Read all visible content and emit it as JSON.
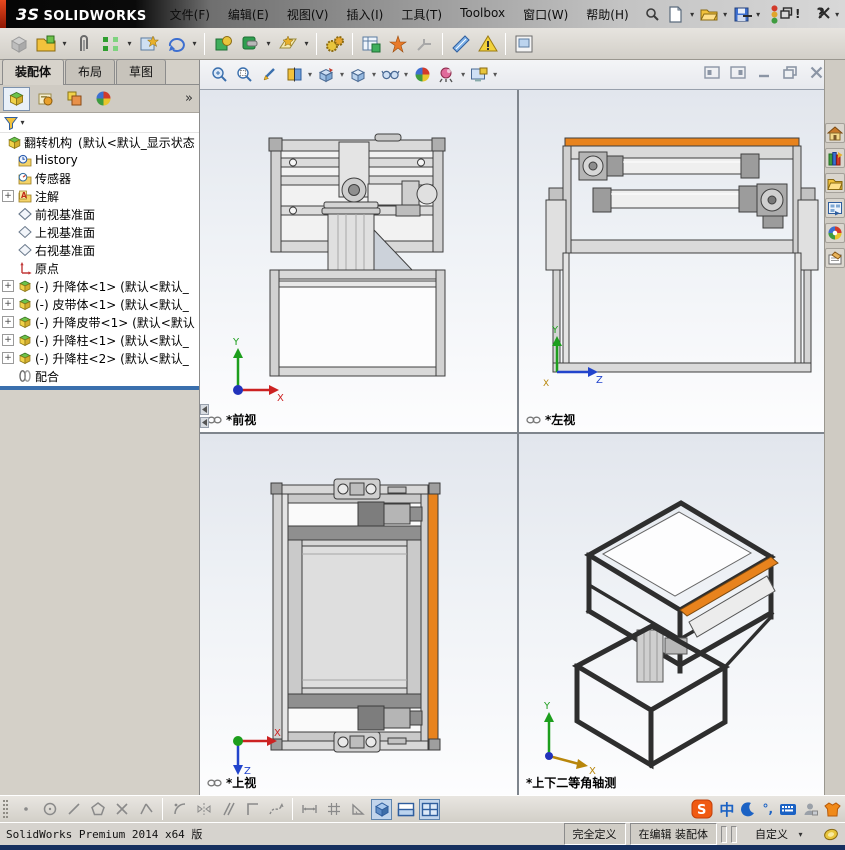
{
  "titlebar": {
    "logo": "3S",
    "brand": "SOLIDWORKS",
    "menus": [
      "文件(F)",
      "编辑(E)",
      "视图(V)",
      "插入(I)",
      "工具(T)",
      "Toolbox",
      "窗口(W)",
      "帮助(H)"
    ],
    "quick_icons": [
      "new-document",
      "open-document",
      "save",
      "status-lights",
      "help"
    ],
    "window_controls": [
      "minimize",
      "restore",
      "close"
    ]
  },
  "assembly_toolbar": {
    "icons": [
      "insert-component",
      "open-part",
      "mate",
      "linear-component-pattern",
      "smart-fasteners",
      "move-component",
      "show-hidden-components",
      "assembly-features",
      "reference-geometry",
      "new-motion-study",
      "bill-of-materials",
      "exploded-view",
      "explode-line-sketch",
      "interference-detection",
      "assembly-xpert",
      "take-snapshot"
    ]
  },
  "left_panel": {
    "tabs": [
      {
        "label": "装配体",
        "active": true
      },
      {
        "label": "布局",
        "active": false
      },
      {
        "label": "草图",
        "active": false
      }
    ],
    "manager_tabs": [
      "featuremanager-design-tree",
      "propertymanager",
      "configurationmanager",
      "displaymanager"
    ],
    "tree": {
      "root_label": "翻转机构",
      "root_suffix": "(默认<默认_显示状态",
      "items": [
        {
          "label": "History",
          "icon": "history-folder"
        },
        {
          "label": "传感器",
          "icon": "sensors-folder"
        },
        {
          "label": "注解",
          "icon": "annotations-folder",
          "expandable": true
        },
        {
          "label": "前视基准面",
          "icon": "reference-plane"
        },
        {
          "label": "上视基准面",
          "icon": "reference-plane"
        },
        {
          "label": "右视基准面",
          "icon": "reference-plane"
        },
        {
          "label": "原点",
          "icon": "origin"
        },
        {
          "label": "(-) 升降体<1> (默认<默认_",
          "icon": "component",
          "expandable": true
        },
        {
          "label": "(-) 皮带体<1> (默认<默认_",
          "icon": "component",
          "expandable": true
        },
        {
          "label": "(-) 升降皮带<1> (默认<默认",
          "icon": "component",
          "expandable": true
        },
        {
          "label": "(-) 升降柱<1> (默认<默认_",
          "icon": "component",
          "expandable": true
        },
        {
          "label": "(-) 升降柱<2> (默认<默认_",
          "icon": "component",
          "expandable": true
        },
        {
          "label": "配合",
          "icon": "mates"
        }
      ]
    }
  },
  "headsup_toolbar": {
    "icons": [
      "zoom-to-fit",
      "zoom-to-area",
      "previous-view",
      "section-view",
      "view-orientation",
      "display-style",
      "hide-show-items",
      "apply-scene",
      "view-settings",
      "screen-options"
    ]
  },
  "child_window_controls": [
    "shortcut-bar-left",
    "shortcut-bar-right",
    "minimize-child",
    "restore-child",
    "close-child"
  ],
  "viewports": [
    {
      "label": "*前视",
      "axes": {
        "up": "Y",
        "right": "X"
      }
    },
    {
      "label": "*左视",
      "axes": {
        "up": "Y",
        "right": "Z",
        "origin": "X"
      }
    },
    {
      "label": "*上视",
      "axes": {
        "right": "X",
        "down": "Z"
      }
    },
    {
      "label": "*上下二等角轴测",
      "axes": {
        "up": "Y",
        "right": "X"
      }
    }
  ],
  "task_pane": {
    "icons": [
      "solidworks-resources-home",
      "design-library",
      "file-explorer",
      "view-palette",
      "appearances-scenes",
      "custom-properties"
    ]
  },
  "sketch_toolbar": {
    "icons": [
      "point",
      "circle",
      "line",
      "polygon",
      "trim-entities",
      "chamfer",
      "fillet",
      "mirror-entities",
      "offset-entities",
      "corner-rectangle",
      "spline",
      "smart-dimension",
      "grid-snap",
      "angle-snap"
    ]
  },
  "view_layout": {
    "buttons": [
      "single-view",
      "two-view-horizontal",
      "four-view"
    ],
    "active": "four-view"
  },
  "ime_bar": {
    "logo": "S",
    "lang": "中",
    "punct": "°,",
    "icons": [
      "sogou-logo",
      "chinese-mode",
      "moon-mode",
      "punctuation",
      "soft-keyboard",
      "account",
      "skin"
    ]
  },
  "statusbar": {
    "app_version": "SolidWorks Premium 2014 x64 版",
    "define_state": "完全定义",
    "edit_state": "在编辑 装配体",
    "custom_label": "自定义"
  },
  "glyphs": {
    "plus": "+",
    "dropdown": "▾",
    "overflow": "»",
    "question": "?",
    "exclaim": "!"
  }
}
